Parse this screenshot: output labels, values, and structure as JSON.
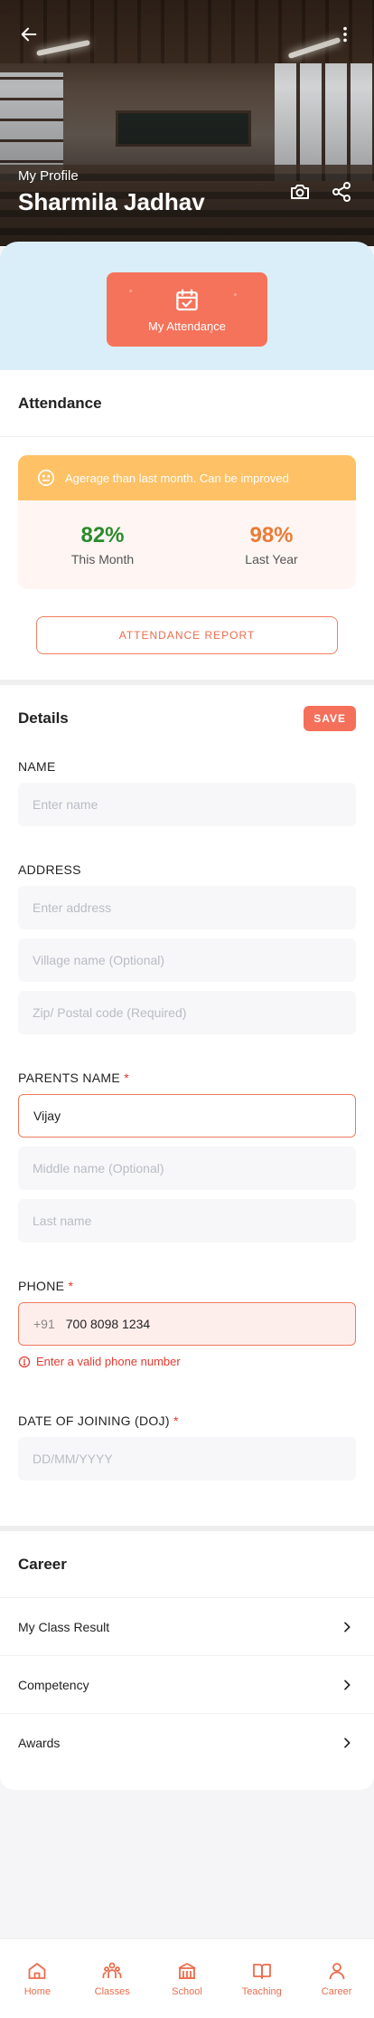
{
  "header": {
    "subtitle": "My Profile",
    "title": "Sharmila Jadhav"
  },
  "banner": {
    "card_label": "My Attendance"
  },
  "attendance": {
    "section_title": "Attendance",
    "message": "Agerage than last month. Can be improved",
    "stats": [
      {
        "value": "82%",
        "caption": "This Month",
        "color": "#2c8a2c"
      },
      {
        "value": "98%",
        "caption": "Last Year",
        "color": "#ea7b37"
      }
    ],
    "report_button": "ATTENDANCE REPORT"
  },
  "details": {
    "section_title": "Details",
    "save_label": "SAVE",
    "name_label": "NAME",
    "name_placeholder": "Enter name",
    "address_label": "ADDRESS",
    "address_placeholder": "Enter address",
    "village_placeholder": "Village name (Optional)",
    "zip_placeholder": "Zip/ Postal code (Required)",
    "parents_label": "PARENTS NAME",
    "parents_first_value": "Vijay",
    "middle_placeholder": "Middle name (Optional)",
    "last_placeholder": "Last name",
    "phone_label": "PHONE",
    "phone_prefix": "+91",
    "phone_value": "700 8098 1234",
    "phone_error": "Enter a valid phone number",
    "doj_label": "DATE OF JOINING (DOJ)",
    "doj_placeholder": "DD/MM/YYYY",
    "required_mark": "*"
  },
  "career": {
    "section_title": "Career",
    "items": [
      {
        "label": "My Class Result"
      },
      {
        "label": "Competency"
      },
      {
        "label": "Awards"
      }
    ]
  },
  "bottom_nav": {
    "items": [
      {
        "label": "Home",
        "icon": "home-icon"
      },
      {
        "label": "Classes",
        "icon": "classes-icon"
      },
      {
        "label": "School",
        "icon": "school-icon"
      },
      {
        "label": "Teaching",
        "icon": "book-icon"
      },
      {
        "label": "Career",
        "icon": "person-icon"
      }
    ]
  },
  "colors": {
    "accent": "#f4705a",
    "warning": "#fec165",
    "banner_bg": "#daeefa",
    "error": "#e43a2f"
  }
}
